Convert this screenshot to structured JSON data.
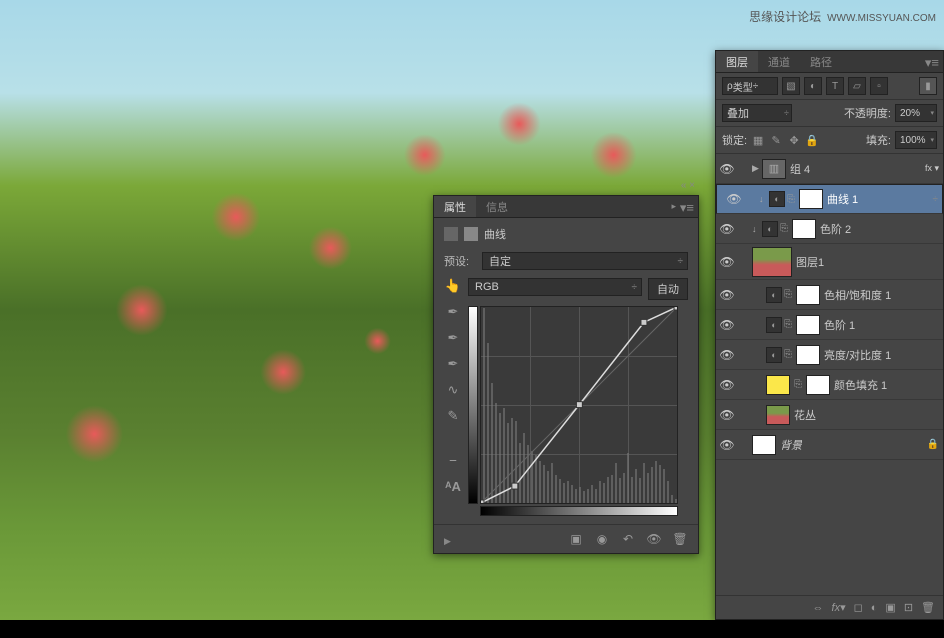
{
  "watermark": {
    "site": "思缘设计论坛",
    "url": "WWW.MISSYUAN.COM"
  },
  "props": {
    "tab_active": "属性",
    "tab_inactive": "信息",
    "adj_name": "曲线",
    "preset_label": "预设:",
    "preset_value": "自定",
    "channel_value": "RGB",
    "auto_btn": "自动"
  },
  "chart_data": {
    "type": "line",
    "title": "曲线",
    "xlabel": "",
    "ylabel": "",
    "xlim": [
      0,
      255
    ],
    "ylim": [
      0,
      255
    ],
    "series": [
      {
        "name": "curve",
        "x": [
          0,
          44,
          128,
          212,
          255
        ],
        "y": [
          0,
          22,
          128,
          235,
          255
        ]
      }
    ],
    "histogram_peaks": [
      {
        "x": 2,
        "h": 195
      },
      {
        "x": 6,
        "h": 160
      },
      {
        "x": 10,
        "h": 120
      },
      {
        "x": 14,
        "h": 100
      },
      {
        "x": 18,
        "h": 90
      },
      {
        "x": 22,
        "h": 95
      },
      {
        "x": 26,
        "h": 80
      },
      {
        "x": 30,
        "h": 85
      },
      {
        "x": 34,
        "h": 82
      },
      {
        "x": 38,
        "h": 60
      },
      {
        "x": 42,
        "h": 70
      },
      {
        "x": 46,
        "h": 58
      },
      {
        "x": 50,
        "h": 52
      },
      {
        "x": 54,
        "h": 48
      },
      {
        "x": 58,
        "h": 42
      },
      {
        "x": 62,
        "h": 38
      },
      {
        "x": 66,
        "h": 32
      },
      {
        "x": 70,
        "h": 40
      },
      {
        "x": 74,
        "h": 28
      },
      {
        "x": 78,
        "h": 24
      },
      {
        "x": 82,
        "h": 20
      },
      {
        "x": 86,
        "h": 22
      },
      {
        "x": 90,
        "h": 18
      },
      {
        "x": 94,
        "h": 14
      },
      {
        "x": 98,
        "h": 16
      },
      {
        "x": 102,
        "h": 12
      },
      {
        "x": 106,
        "h": 14
      },
      {
        "x": 110,
        "h": 18
      },
      {
        "x": 114,
        "h": 14
      },
      {
        "x": 118,
        "h": 22
      },
      {
        "x": 122,
        "h": 20
      },
      {
        "x": 126,
        "h": 26
      },
      {
        "x": 130,
        "h": 28
      },
      {
        "x": 134,
        "h": 40
      },
      {
        "x": 138,
        "h": 25
      },
      {
        "x": 142,
        "h": 30
      },
      {
        "x": 146,
        "h": 50
      },
      {
        "x": 150,
        "h": 26
      },
      {
        "x": 154,
        "h": 34
      },
      {
        "x": 158,
        "h": 25
      },
      {
        "x": 162,
        "h": 40
      },
      {
        "x": 166,
        "h": 30
      },
      {
        "x": 170,
        "h": 36
      },
      {
        "x": 174,
        "h": 42
      },
      {
        "x": 178,
        "h": 38
      },
      {
        "x": 182,
        "h": 34
      },
      {
        "x": 186,
        "h": 22
      },
      {
        "x": 190,
        "h": 8
      },
      {
        "x": 194,
        "h": 4
      }
    ]
  },
  "layers": {
    "tab1": "图层",
    "tab2": "通道",
    "tab3": "路径",
    "filter_kind": "类型",
    "blend_mode": "叠加",
    "opacity_label": "不透明度:",
    "opacity_value": "20%",
    "lock_label": "锁定:",
    "fill_label": "填充:",
    "fill_value": "100%",
    "items": [
      {
        "name": "组 4",
        "type": "group"
      },
      {
        "name": "曲线 1",
        "type": "adj",
        "selected": true,
        "clip": true
      },
      {
        "name": "色阶 2",
        "type": "adj",
        "clip": true
      },
      {
        "name": "图层1",
        "type": "image"
      },
      {
        "name": "色相/饱和度 1",
        "type": "adj"
      },
      {
        "name": "色阶 1",
        "type": "adj"
      },
      {
        "name": "亮度/对比度 1",
        "type": "adj"
      },
      {
        "name": "颜色填充 1",
        "type": "fill"
      },
      {
        "name": "花丛",
        "type": "image-small"
      },
      {
        "name": "背景",
        "type": "bg"
      }
    ]
  }
}
